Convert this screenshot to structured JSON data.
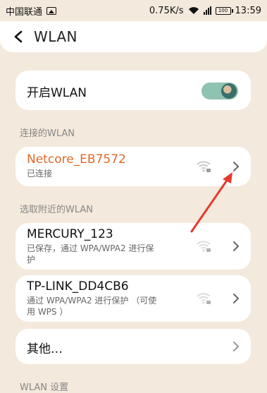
{
  "status_bar": {
    "carrier": "中国联通",
    "network_speed": "0.75K/s",
    "battery": "100",
    "time": "13:59"
  },
  "header": {
    "title": "WLAN"
  },
  "wlan_toggle": {
    "label": "开启WLAN",
    "enabled": true
  },
  "connected_section": {
    "label": "连接的WLAN",
    "network": {
      "name": "Netcore_EB7572",
      "status": "已连接",
      "name_color": "#e06a2b"
    }
  },
  "nearby_section": {
    "label": "选取附近的WLAN",
    "networks": [
      {
        "name": "MERCURY_123",
        "line1": "已保存，通过 WPA/WPA2 进行保",
        "line2": "护"
      },
      {
        "name": "TP-LINK_DD4CB6",
        "line1": "通过 WPA/WPA2 进行保护 （可使",
        "line2": "用 WPS ）"
      }
    ],
    "other_label": "其他…"
  },
  "settings_section": {
    "label": "WLAN 设置"
  },
  "annotation": {
    "color": "#e53a2f"
  }
}
